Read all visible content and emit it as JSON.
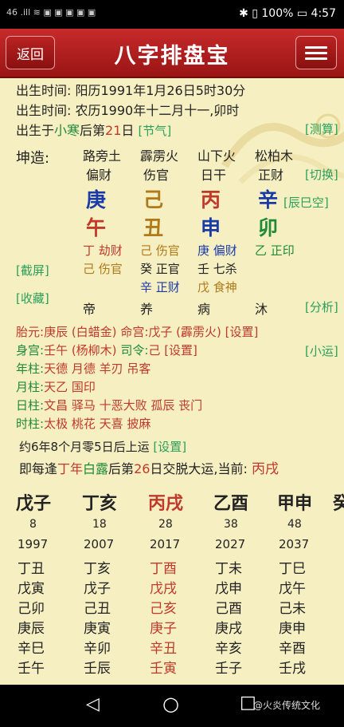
{
  "status": {
    "left_icons": "46 .ill ≋ ▣ ▣ ▣ ▣ ▣",
    "right": "✱ ▯ 100% ▭ 4:57"
  },
  "header": {
    "back": "返回",
    "title": "八字排盘宝"
  },
  "birth": {
    "solar": "出生时间: 阳历1991年1月26日5时30分",
    "lunar": "出生时间: 农历1990年十二月十一,卯时",
    "solar_term_prefix": "出生于",
    "solar_term": "小寒",
    "after": "后第",
    "days": "21",
    "day_unit": "日",
    "jieqi_link": "[节气]",
    "cesuan_link": "[测算]"
  },
  "chart": {
    "label": "坤造:",
    "switch_link": "[切换]",
    "kong_link": "[辰巳空]",
    "screenshot_link": "[截屏]",
    "collect_link": "[收藏]",
    "analysis_link": "[分析]",
    "pillars": [
      {
        "nayin": "路旁土",
        "ten_god": "偏财",
        "stem": "庚",
        "branch": "午",
        "stem_color": "#1a3aa8",
        "branch_color": "#c0392b",
        "hidden": [
          "丁 劫财",
          "己 伤官"
        ],
        "hidden_colors": [
          "#c0392b",
          "#b07a1a"
        ],
        "stage": "帝"
      },
      {
        "nayin": "霹雳火",
        "ten_god": "伤官",
        "stem": "己",
        "branch": "丑",
        "stem_color": "#b07a1a",
        "branch_color": "#b07a1a",
        "hidden": [
          "己 伤官",
          "癸 正官",
          "辛 正财"
        ],
        "hidden_colors": [
          "#b07a1a",
          "#222222",
          "#1a3aa8"
        ],
        "stage": "养"
      },
      {
        "nayin": "山下火",
        "ten_god": "日干",
        "stem": "丙",
        "branch": "申",
        "stem_color": "#c0392b",
        "branch_color": "#1a3aa8",
        "hidden": [
          "庚 偏财",
          "壬 七杀",
          "戊 食神"
        ],
        "hidden_colors": [
          "#1a3aa8",
          "#222222",
          "#b07a1a"
        ],
        "stage": "病"
      },
      {
        "nayin": "松柏木",
        "ten_god": "正财",
        "stem": "辛",
        "branch": "卯",
        "stem_color": "#1a3aa8",
        "branch_color": "#1f8a3a",
        "hidden": [
          "乙 正印"
        ],
        "hidden_colors": [
          "#1f8a3a"
        ],
        "stage": "沐"
      }
    ]
  },
  "info": {
    "taiyuan": {
      "label": "胎元:",
      "value": "庚辰 (白蜡金)"
    },
    "minggong": {
      "label": "命宫:",
      "value": "戊子 (霹雳火)"
    },
    "set1": "[设置]",
    "shengong": {
      "label": "身宫:",
      "value": "壬午 (杨柳木)"
    },
    "siling": {
      "label": "司令:",
      "value": "己"
    },
    "set2": "[设置]",
    "xiaoyun_link": "[小运]",
    "shensha": [
      {
        "label": "年柱:",
        "value": "天德 月德 羊刃 吊客"
      },
      {
        "label": "月柱:",
        "value": "天乙 国印"
      },
      {
        "label": "日柱:",
        "value": "文昌 驿马 十恶大败 孤辰 丧门"
      },
      {
        "label": "时柱:",
        "value": "太极 桃花 天喜 披麻"
      }
    ],
    "qiyun": "约6年8个月零5日后上运",
    "set3": "[设置]",
    "dayun_prefix": "即每逢",
    "dayun_stem": "丁年",
    "dayun_term": "白露",
    "dayun_mid": "后第",
    "dayun_days": "26",
    "dayun_suffix": "日交脱大运,当前:",
    "dayun_current": "丙戌"
  },
  "dayun": {
    "columns": [
      {
        "gz": "戊子",
        "age": "8",
        "year": "1997",
        "years": [
          "丁丑",
          "戊寅",
          "己卯",
          "庚辰",
          "辛巳",
          "壬午"
        ],
        "current": false
      },
      {
        "gz": "丁亥",
        "age": "18",
        "year": "2007",
        "years": [
          "丁亥",
          "戊子",
          "己丑",
          "庚寅",
          "辛卯",
          "壬辰"
        ],
        "current": false
      },
      {
        "gz": "丙戌",
        "age": "28",
        "year": "2017",
        "years": [
          "丁酉",
          "戊戌",
          "己亥",
          "庚子",
          "辛丑",
          "壬寅"
        ],
        "current": true
      },
      {
        "gz": "乙酉",
        "age": "38",
        "year": "2027",
        "years": [
          "丁未",
          "戊申",
          "己酉",
          "庚戌",
          "辛亥",
          "壬子"
        ],
        "current": false
      },
      {
        "gz": "甲申",
        "age": "48",
        "year": "2037",
        "years": [
          "丁巳",
          "戊午",
          "己未",
          "庚申",
          "辛酉",
          "壬戌"
        ],
        "current": false
      }
    ],
    "partial": "癸"
  },
  "nav": {
    "back": "◁",
    "home": "○",
    "recent": "□",
    "watermark": "@火炎传统文化"
  }
}
